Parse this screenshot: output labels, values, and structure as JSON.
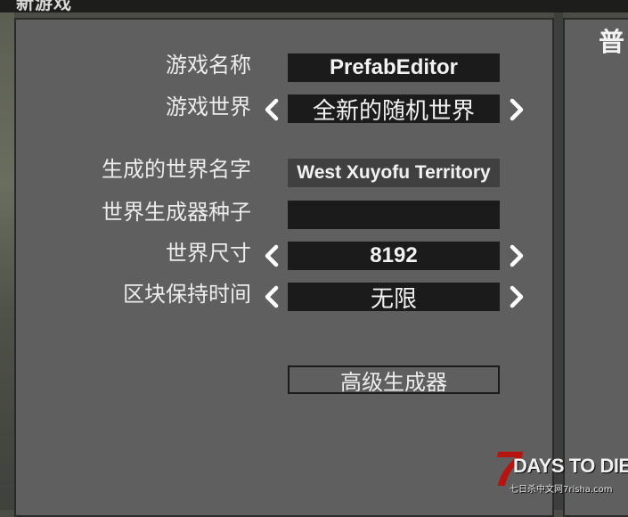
{
  "header": {
    "title": "新游戏"
  },
  "right_panel": {
    "title": "普"
  },
  "settings": {
    "game_name": {
      "label": "游戏名称",
      "value": "PrefabEditor"
    },
    "game_world": {
      "label": "游戏世界",
      "value": "全新的随机世界"
    },
    "generated_name": {
      "label": "生成的世界名字",
      "value": "West Xuyofu Territory"
    },
    "seed": {
      "label": "世界生成器种子",
      "value": ""
    },
    "world_size": {
      "label": "世界尺寸",
      "value": "8192"
    },
    "chunk_retention": {
      "label": "区块保持时间",
      "value": "无限"
    }
  },
  "buttons": {
    "advanced_generator": "高级生成器"
  },
  "watermark": {
    "logo_digit": "7",
    "logo_text": "DAYS TO DIE",
    "site_text": "七日杀中文网7risha.com"
  },
  "colors": {
    "panel": "#5f5f5f",
    "field": "#1b1b1b",
    "logo_red": "#b8140f"
  },
  "icons": {
    "prev": "chevron-left-icon",
    "next": "chevron-right-icon"
  }
}
